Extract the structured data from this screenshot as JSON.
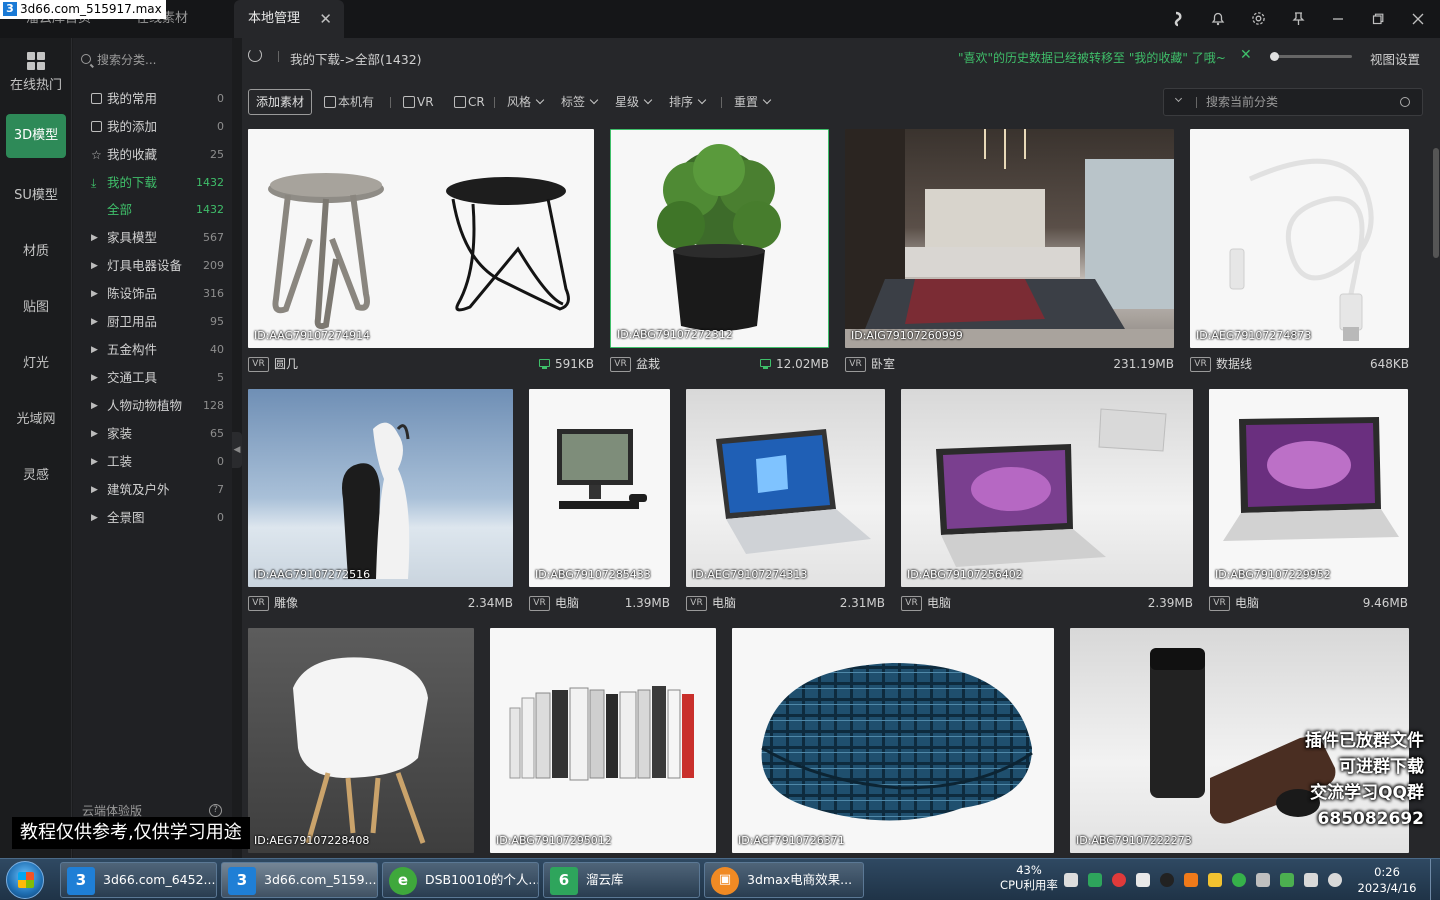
{
  "window_title": "3d66.com_515917.max",
  "tabs": {
    "home": "溜云库首页",
    "online": "在线素材",
    "local": "本地管理",
    "close": "✕"
  },
  "rail": [
    {
      "label": "在线热门"
    },
    {
      "label": "3D模型"
    },
    {
      "label": "SU模型"
    },
    {
      "label": "材质"
    },
    {
      "label": "贴图"
    },
    {
      "label": "灯光"
    },
    {
      "label": "光域网"
    },
    {
      "label": "灵感"
    }
  ],
  "category_search_placeholder": "搜索分类...",
  "categories": [
    {
      "label": "我的常用",
      "count": "0"
    },
    {
      "label": "我的添加",
      "count": "0"
    },
    {
      "label": "我的收藏",
      "count": "25"
    },
    {
      "label": "我的下载",
      "count": "1432"
    },
    {
      "label": "全部",
      "count": "1432"
    },
    {
      "label": "家具模型",
      "count": "567"
    },
    {
      "label": "灯具电器设备",
      "count": "209"
    },
    {
      "label": "陈设饰品",
      "count": "316"
    },
    {
      "label": "厨卫用品",
      "count": "95"
    },
    {
      "label": "五金构件",
      "count": "40"
    },
    {
      "label": "交通工具",
      "count": "5"
    },
    {
      "label": "人物动物植物",
      "count": "128"
    },
    {
      "label": "家装",
      "count": "65"
    },
    {
      "label": "工装",
      "count": "0"
    },
    {
      "label": "建筑及户外",
      "count": "7"
    },
    {
      "label": "全景图",
      "count": "0"
    }
  ],
  "cloud_label": "云端体验版",
  "path_text": "我的下载->全部(1432)",
  "notice": "\"喜欢\"的历史数据已经被转移至 \"我的收藏\" 了哦~",
  "view_settings": "视图设置",
  "filters": {
    "add_button": "添加素材",
    "local_only": "本机有",
    "vr": "VR",
    "cr": "CR",
    "style": "风格",
    "tag": "标签",
    "star": "星级",
    "sort": "排序",
    "reset": "重置",
    "search_placeholder": "搜索当前分类"
  },
  "items": [
    {
      "id": "ID:AAG79107274914",
      "name": "圆几",
      "size": "591KB",
      "badge": "VR",
      "downloaded": true
    },
    {
      "id": "ID:ABG79107272312",
      "name": "盆栽",
      "size": "12.02MB",
      "badge": "VR",
      "downloaded": true
    },
    {
      "id": "ID:AIG79107260999",
      "name": "卧室",
      "size": "231.19MB",
      "badge": "VR",
      "downloaded": false
    },
    {
      "id": "ID:AEG79107274873",
      "name": "数据线",
      "size": "648KB",
      "badge": "VR",
      "downloaded": false
    },
    {
      "id": "ID:AAG79107272516",
      "name": "雕像",
      "size": "2.34MB",
      "badge": "VR",
      "downloaded": false
    },
    {
      "id": "ID:ABG79107285433",
      "name": "电脑",
      "size": "1.39MB",
      "badge": "VR",
      "downloaded": false
    },
    {
      "id": "ID:AEG79107274313",
      "name": "电脑",
      "size": "2.31MB",
      "badge": "VR",
      "downloaded": false
    },
    {
      "id": "ID:ABG79107256402",
      "name": "电脑",
      "size": "2.39MB",
      "badge": "VR",
      "downloaded": false
    },
    {
      "id": "ID:ABG79107229952",
      "name": "电脑",
      "size": "9.46MB",
      "badge": "VR",
      "downloaded": false
    },
    {
      "id": "ID:AEG79107228408"
    },
    {
      "id": "ID:ABG79107295012"
    },
    {
      "id": "ID:ACF7910726371"
    },
    {
      "id": "ID:ABG79107222273"
    }
  ],
  "captions": {
    "left": "教程仅供参考,仅供学习用途",
    "right_lines": [
      "插件已放群文件",
      "可进群下载",
      "交流学习QQ群",
      "685082692"
    ]
  },
  "taskbar": {
    "tasks": [
      {
        "label": "3d66.com_6452...",
        "icon_text": "3",
        "color": "#1f7fd6"
      },
      {
        "label": "3d66.com_5159...",
        "icon_text": "3",
        "color": "#1f7fd6"
      },
      {
        "label": "DSB10010的个人...",
        "icon_text": "e",
        "color": "#3fa83c"
      },
      {
        "label": "溜云库",
        "icon_text": "6",
        "color": "#2ea55c"
      },
      {
        "label": "3dmax电商效果...",
        "icon_text": "▣",
        "color": "#f08a24"
      }
    ],
    "cpu_percent": "43%",
    "cpu_label": "CPU利用率",
    "time": "0:26",
    "date": "2023/4/16"
  },
  "colors": {
    "accent_green": "#3fbf6a",
    "rail_active": "#2e8a58"
  }
}
